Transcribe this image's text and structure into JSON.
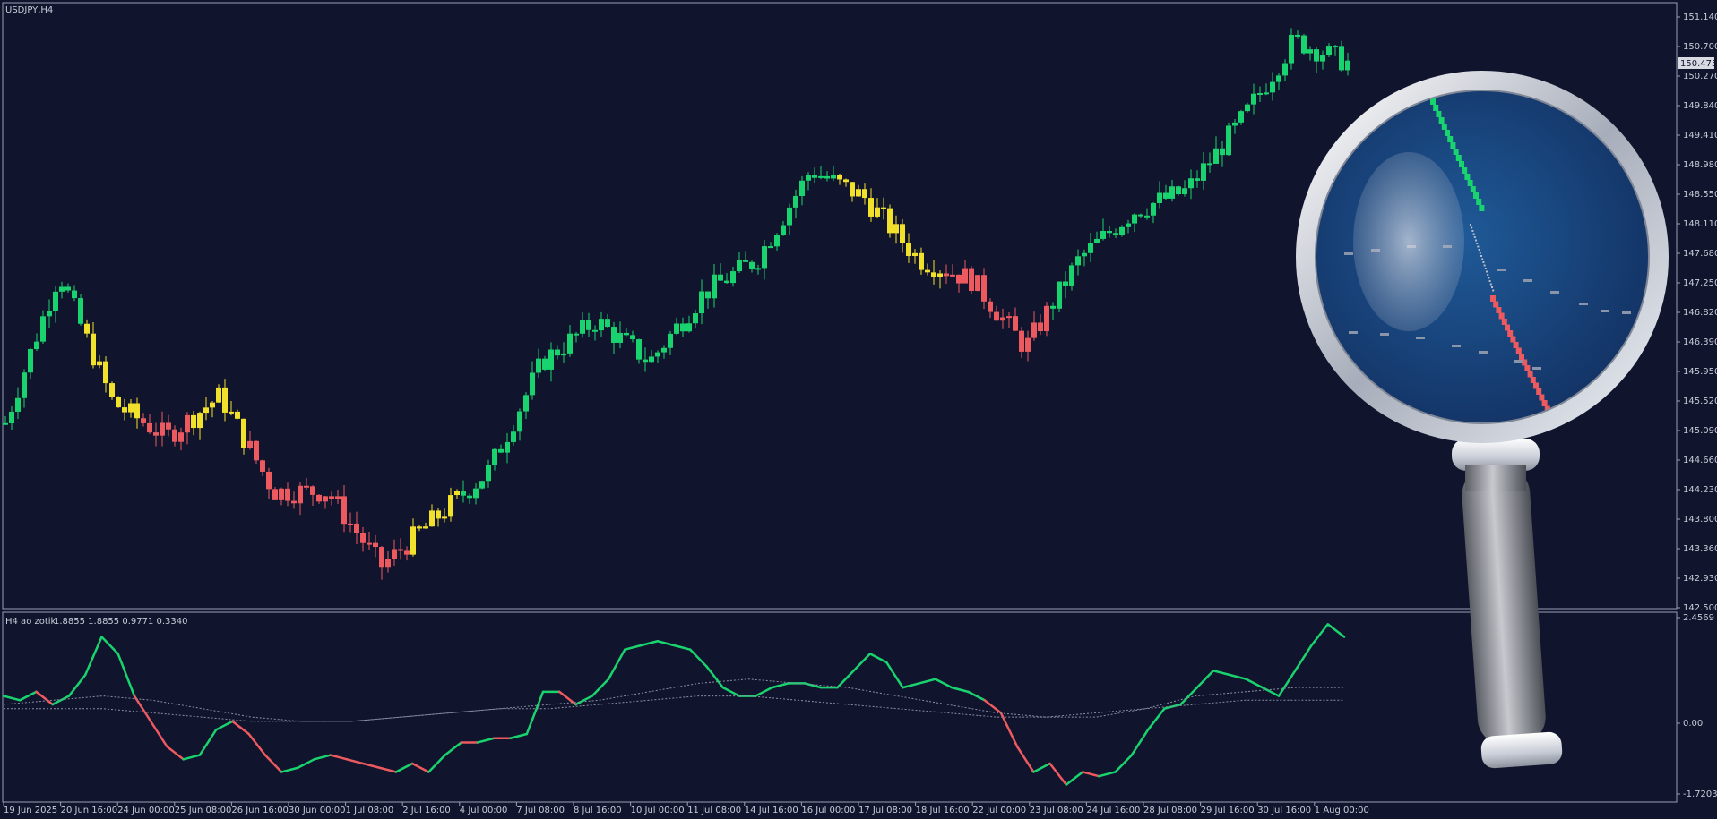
{
  "window": {
    "symbol_title": "USDJPY,H4",
    "indicator_title": "H4 ao zotik",
    "indicator_values": "1.8855 1.8855 0.9771 0.3340"
  },
  "colors": {
    "background": "#11142d",
    "grid_border": "#9aa0b4",
    "bull": "#19d36e",
    "bear": "#ec5a5f",
    "neutral": "#f2e12a",
    "text": "#c8cbd6",
    "dots": "#8a8fa3",
    "magnifier_lens": "#1d4f86",
    "magnifier_rim": "#c9ced8"
  },
  "price_axis": {
    "ticks": [
      "151.140",
      "150.700",
      "150.270",
      "149.840",
      "149.410",
      "148.980",
      "148.550",
      "148.110",
      "147.680",
      "147.250",
      "146.820",
      "146.390",
      "145.950",
      "145.520",
      "145.090",
      "144.660",
      "144.230",
      "143.800",
      "143.360",
      "142.930",
      "142.500"
    ],
    "current_price": "150.475"
  },
  "indicator_axis": {
    "ticks": [
      "2.4569",
      "0.00",
      "-1.7203"
    ]
  },
  "time_axis": {
    "labels": [
      "19 Jun 2025",
      "20 Jun 16:00",
      "24 Jun 00:00",
      "25 Jun 08:00",
      "26 Jun 16:00",
      "30 Jun 00:00",
      "1 Jul 08:00",
      "2 Jul 16:00",
      "4 Jul 00:00",
      "7 Jul 08:00",
      "8 Jul 16:00",
      "10 Jul 00:00",
      "11 Jul 08:00",
      "14 Jul 16:00",
      "16 Jul 00:00",
      "17 Jul 08:00",
      "18 Jul 16:00",
      "22 Jul 00:00",
      "23 Jul 08:00",
      "24 Jul 16:00",
      "28 Jul 08:00",
      "29 Jul 16:00",
      "30 Jul 16:00",
      "1 Aug 00:00"
    ]
  },
  "chart_data": [
    {
      "type": "candlestick",
      "title": "USDJPY,H4",
      "ylim": [
        142.5,
        151.14
      ],
      "close_path": [
        {
          "t": "19 Jun 2025",
          "close": 145.2,
          "color": "bull"
        },
        {
          "t": "20 Jun 16:00",
          "close": 147.4,
          "color": "bull"
        },
        {
          "t": "24 Jun 00:00",
          "close": 145.5,
          "color": "neutral"
        },
        {
          "t": "24 Jun 00:00",
          "close": 145.0,
          "color": "bear"
        },
        {
          "t": "25 Jun 08:00",
          "close": 145.6,
          "color": "neutral"
        },
        {
          "t": "26 Jun 16:00",
          "close": 144.2,
          "color": "bear"
        },
        {
          "t": "30 Jun 00:00",
          "close": 144.2,
          "color": "bear"
        },
        {
          "t": "1 Jul 08:00",
          "close": 143.1,
          "color": "bear"
        },
        {
          "t": "2 Jul 16:00",
          "close": 143.8,
          "color": "neutral"
        },
        {
          "t": "4 Jul 00:00",
          "close": 144.5,
          "color": "bull"
        },
        {
          "t": "7 Jul 08:00",
          "close": 146.1,
          "color": "bull"
        },
        {
          "t": "8 Jul 16:00",
          "close": 146.7,
          "color": "bull"
        },
        {
          "t": "10 Jul 00:00",
          "close": 146.1,
          "color": "bull"
        },
        {
          "t": "11 Jul 08:00",
          "close": 147.1,
          "color": "bull"
        },
        {
          "t": "14 Jul 16:00",
          "close": 147.6,
          "color": "bull"
        },
        {
          "t": "16 Jul 00:00",
          "close": 148.9,
          "color": "bull"
        },
        {
          "t": "17 Jul 08:00",
          "close": 148.5,
          "color": "neutral"
        },
        {
          "t": "18 Jul 16:00",
          "close": 147.6,
          "color": "neutral"
        },
        {
          "t": "22 Jul 00:00",
          "close": 147.3,
          "color": "bear"
        },
        {
          "t": "23 Jul 08:00",
          "close": 146.3,
          "color": "bear"
        },
        {
          "t": "24 Jul 16:00",
          "close": 147.6,
          "color": "bull"
        },
        {
          "t": "28 Jul 08:00",
          "close": 148.3,
          "color": "bull"
        },
        {
          "t": "29 Jul 16:00",
          "close": 148.6,
          "color": "bull"
        },
        {
          "t": "30 Jul 16:00",
          "close": 149.6,
          "color": "bull"
        },
        {
          "t": "1 Aug 00:00",
          "close": 150.8,
          "color": "bull"
        },
        {
          "t": "1 Aug 00:00",
          "close": 150.475,
          "color": "bull"
        }
      ]
    },
    {
      "type": "line",
      "title": "H4 ao zotik",
      "ylim": [
        -1.7203,
        2.4569
      ],
      "series": [
        {
          "name": "",
          "values": [
            0.6,
            0.5,
            0.7,
            0.4,
            0.6,
            1.1,
            2.0,
            1.6,
            0.6,
            0.0,
            -0.6,
            -0.9,
            -0.8,
            -0.2,
            0.0,
            -0.3,
            -0.8,
            -1.2,
            -1.1,
            -0.9,
            -0.8,
            -0.9,
            -1.0,
            -1.1,
            -1.2,
            -1.0,
            -1.2,
            -0.8,
            -0.5,
            -0.5,
            -0.4,
            -0.4,
            -0.3,
            0.7,
            0.7,
            0.4,
            0.6,
            1.0,
            1.7,
            1.8,
            1.9,
            1.8,
            1.7,
            1.3,
            0.8,
            0.6,
            0.6,
            0.8,
            0.9,
            0.9,
            0.8,
            0.8,
            1.2,
            1.6,
            1.4,
            0.8,
            0.9,
            1.0,
            0.8,
            0.7,
            0.5,
            0.2,
            -0.6,
            -1.2,
            -1.0,
            -1.5,
            -1.2,
            -1.3,
            -1.2,
            -0.8,
            -0.2,
            0.3,
            0.4,
            0.8,
            1.2,
            1.1,
            1.0,
            0.8,
            0.6,
            1.2,
            1.8,
            2.3,
            2.0
          ]
        },
        {
          "name": "",
          "values": [
            0.4,
            0.5,
            0.6,
            0.5,
            0.3,
            0.1,
            0.0,
            0.0,
            0.1,
            0.2,
            0.3,
            0.4,
            0.5,
            0.7,
            0.9,
            1.0,
            0.9,
            0.8,
            0.6,
            0.4,
            0.2,
            0.1,
            0.1,
            0.3,
            0.6,
            0.7,
            0.8,
            0.8
          ]
        },
        {
          "name": "",
          "values": [
            0.3,
            0.3,
            0.3,
            0.2,
            0.1,
            0.0,
            0.0,
            0.0,
            0.1,
            0.2,
            0.3,
            0.3,
            0.4,
            0.5,
            0.6,
            0.6,
            0.5,
            0.4,
            0.3,
            0.2,
            0.1,
            0.1,
            0.2,
            0.3,
            0.4,
            0.5,
            0.5,
            0.5
          ]
        }
      ]
    }
  ]
}
